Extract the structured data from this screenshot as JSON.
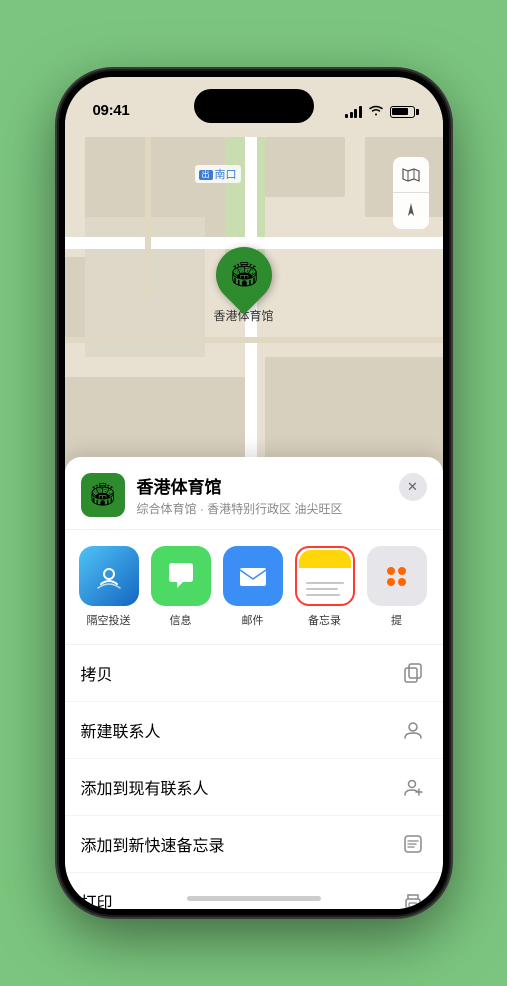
{
  "status": {
    "time": "09:41",
    "location_arrow": "▲"
  },
  "map": {
    "label_icon": "出",
    "label_text": "南口"
  },
  "venue": {
    "name": "香港体育馆",
    "subtitle": "综合体育馆 · 香港特别行政区 油尖旺区",
    "pin_label": "香港体育馆",
    "icon": "🏟"
  },
  "share_items": [
    {
      "id": "airdrop",
      "label": "隔空投送",
      "icon_type": "airdrop"
    },
    {
      "id": "messages",
      "label": "信息",
      "icon_type": "messages"
    },
    {
      "id": "mail",
      "label": "邮件",
      "icon_type": "mail"
    },
    {
      "id": "notes",
      "label": "备忘录",
      "icon_type": "notes"
    },
    {
      "id": "more",
      "label": "提",
      "icon_type": "more"
    }
  ],
  "actions": [
    {
      "id": "copy",
      "label": "拷贝",
      "icon": "copy"
    },
    {
      "id": "new-contact",
      "label": "新建联系人",
      "icon": "person"
    },
    {
      "id": "add-existing",
      "label": "添加到现有联系人",
      "icon": "person-add"
    },
    {
      "id": "add-notes",
      "label": "添加到新快速备忘录",
      "icon": "note"
    },
    {
      "id": "print",
      "label": "打印",
      "icon": "print"
    }
  ],
  "controls": {
    "map_icon": "🗺",
    "location_icon": "➤"
  }
}
